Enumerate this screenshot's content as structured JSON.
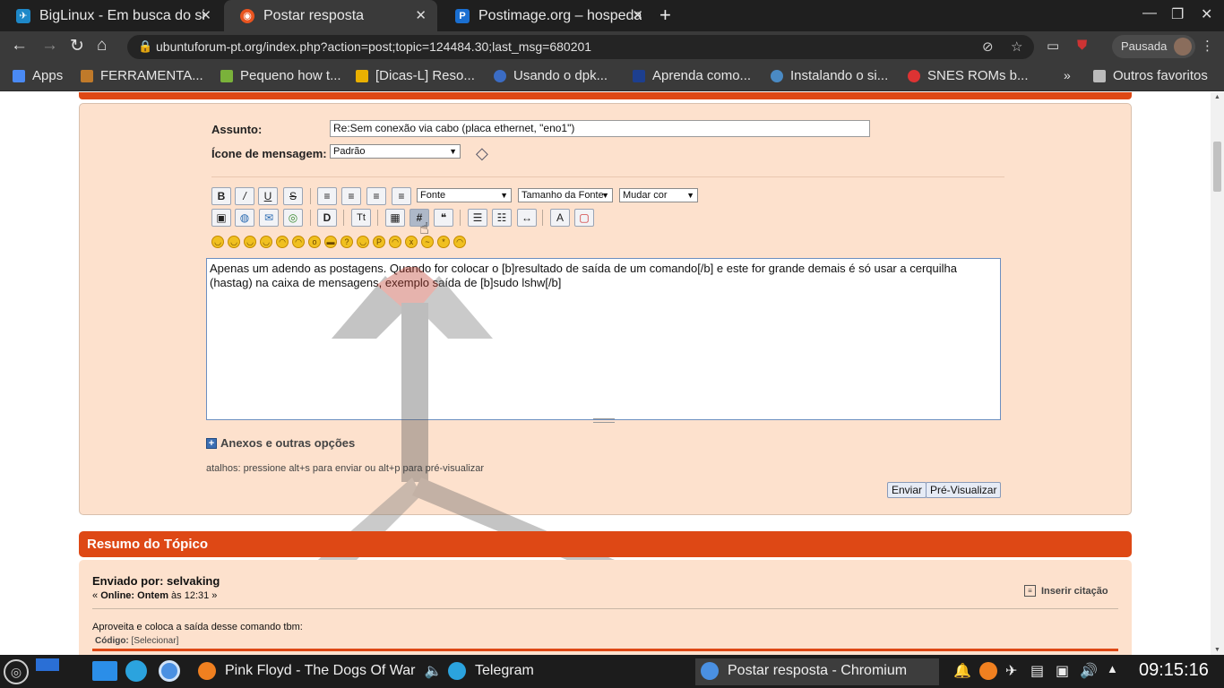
{
  "browser": {
    "tabs": [
      {
        "title": "BigLinux - Em busca do si",
        "favicon": "biglinux-icon",
        "color": "#1e88c8"
      },
      {
        "title": "Postar resposta",
        "favicon": "ubuntu-icon",
        "color": "#e95420"
      },
      {
        "title": "Postimage.org – hospeda",
        "favicon": "postimage-icon",
        "color": "#1a6fd1"
      }
    ],
    "url": "ubuntuforum-pt.org/index.php?action=post;topic=124484.30;last_msg=680201",
    "profile_label": "Pausada",
    "bookmarks": [
      {
        "label": "Apps",
        "color": "#4a8af4"
      },
      {
        "label": "FERRAMENTA...",
        "color": "#c07a2a"
      },
      {
        "label": "Pequeno how t...",
        "color": "#7ab23a"
      },
      {
        "label": "[Dicas-L] Reso...",
        "color": "#e9b000"
      },
      {
        "label": "Usando o dpk...",
        "color": "#3b6cc4"
      },
      {
        "label": "Aprenda como...",
        "color": "#1d3f8f"
      },
      {
        "label": "Instalando o si...",
        "color": "#4a8ac4"
      },
      {
        "label": "SNES ROMs b...",
        "color": "#d33"
      }
    ],
    "other_bookmarks": "Outros favoritos"
  },
  "form": {
    "subject_label": "Assunto:",
    "subject_value": "Re:Sem conexão via cabo (placa ethernet, \"eno1\")",
    "icon_label": "Ícone de mensagem:",
    "icon_value": "Padrão",
    "font_select": "Fonte",
    "size_select": "Tamanho da Fonte",
    "color_select": "Mudar cor",
    "message": "Apenas um adendo as postagens. Quando for colocar o [b]resultado de saída de um comando[/b] e este for grande demais é só usar a cerquilha (hastag) na caixa de mensagens, exemplo saída de [b]sudo lshw[/b]",
    "attachments_label": "Anexos e outras opções",
    "shortcuts": "atalhos: pressione alt+s para enviar ou alt+p para pré-visualizar",
    "send": "Enviar",
    "preview": "Pré-Visualizar"
  },
  "summary": {
    "header": "Resumo do Tópico",
    "posted_by": "Enviado por: selvaking",
    "online_prefix": "« ",
    "online_label": "Online:",
    "online_when": "Ontem",
    "online_time": "às 12:31 »",
    "quote_label": "Inserir citação",
    "body": "Aproveita e coloca a saída desse comando tbm:",
    "code_label": "Código:",
    "code_select": "[Selecionar]"
  },
  "taskbar": {
    "music": "Pink Floyd - The Dogs Of War",
    "telegram": "Telegram",
    "active_window": "Postar resposta - Chromium",
    "clock": "09:15:16"
  },
  "colors": {
    "accent": "#de4815",
    "panel": "#fde1cd"
  }
}
